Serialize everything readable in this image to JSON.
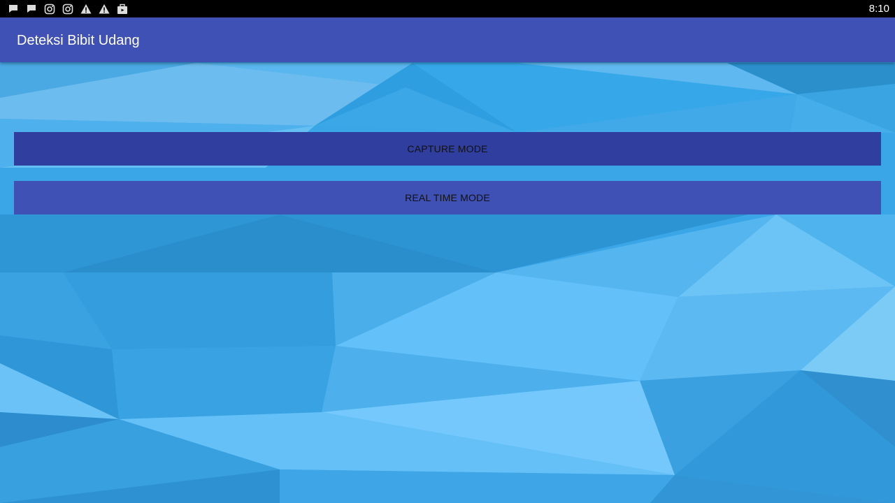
{
  "status_bar": {
    "time": "8:10",
    "icons": [
      "chat-bubble-icon",
      "chat-bubble-icon",
      "instagram-icon",
      "instagram-icon",
      "warning-icon",
      "warning-icon",
      "briefcase-icon"
    ]
  },
  "app_bar": {
    "title": "Deteksi Bibit Udang"
  },
  "buttons": {
    "capture_label": "CAPTURE MODE",
    "realtime_label": "REAL TIME MODE"
  },
  "colors": {
    "app_bar": "#3f51b5",
    "capture_button": "#303f9f",
    "realtime_button": "#3f51b5",
    "status_bar": "#000000"
  }
}
